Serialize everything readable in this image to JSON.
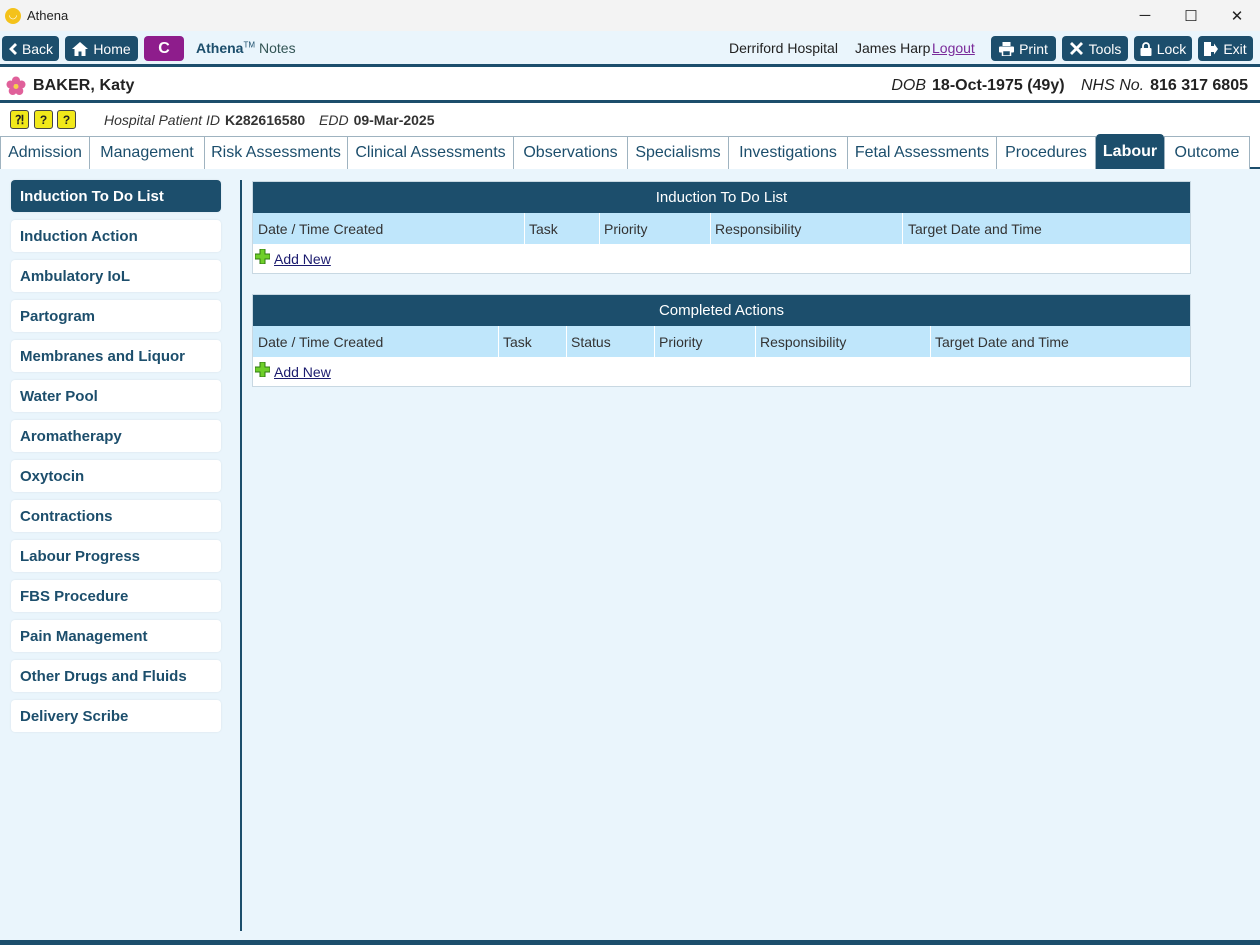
{
  "window": {
    "title": "Athena",
    "minimize": "─",
    "maximize": "☐",
    "close": "✕"
  },
  "toolbar": {
    "back": "Back",
    "home": "Home",
    "c_label": "C",
    "brand": "Athena",
    "brand_tm": "TM",
    "brand_suffix": "Notes",
    "hospital": "Derriford Hospital",
    "user": "James Harp",
    "logout": "Logout",
    "print": "Print",
    "tools": "Tools",
    "lock": "Lock",
    "exit": "Exit"
  },
  "patient": {
    "name": "BAKER, Katy",
    "dob_label": "DOB",
    "dob": "18-Oct-1975 (49y)",
    "nhs_label": "NHS No.",
    "nhs": "816 317 6805",
    "hpid_label": "Hospital Patient ID",
    "hpid": "K282616580",
    "edd_label": "EDD",
    "edd": "09-Mar-2025"
  },
  "tabs": [
    "Admission",
    "Management",
    "Risk Assessments",
    "Clinical Assessments",
    "Observations",
    "Specialisms",
    "Investigations",
    "Fetal Assessments",
    "Procedures",
    "Labour",
    "Outcome"
  ],
  "active_tab": "Labour",
  "sidebar": [
    "Induction To Do List",
    "Induction Action",
    "Ambulatory IoL",
    "Partogram",
    "Membranes and Liquor",
    "Water Pool",
    "Aromatherapy",
    "Oxytocin",
    "Contractions",
    "Labour Progress",
    "FBS Procedure",
    "Pain Management",
    "Other Drugs and Fluids",
    "Delivery Scribe"
  ],
  "panels": {
    "todo": {
      "title": "Induction To Do List",
      "columns": [
        "Date / Time Created",
        "Task",
        "Priority",
        "Responsibility",
        "Target Date and Time"
      ],
      "add_new": "Add New"
    },
    "completed": {
      "title": "Completed Actions",
      "columns": [
        "Date / Time Created",
        "Task",
        "Status",
        "Priority",
        "Responsibility",
        "Target Date and Time"
      ],
      "add_new": "Add New"
    }
  },
  "colors": {
    "primary": "#1c4e6c",
    "accent_purple": "#8e1d8c",
    "header_bg": "#bfe6fb",
    "content_bg": "#eaf5fc"
  }
}
